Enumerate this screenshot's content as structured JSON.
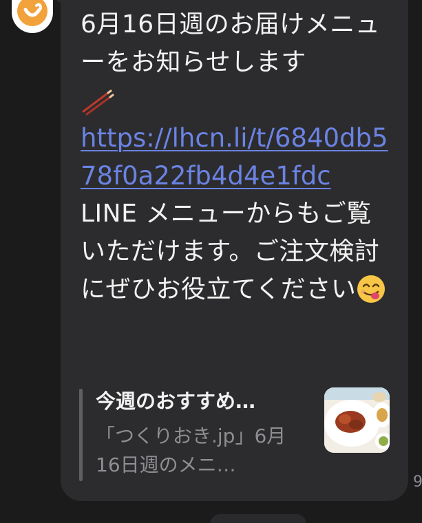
{
  "message": {
    "line1": "6月16日週のお届けメニューをお知らせします",
    "link": "https://lhcn.li/t/6840db578f0a22fb4d4e1fdc",
    "body": "LINE メニューからもご覧いただけます。ご注文検討にぜひお役立てください",
    "emoji_icon": "yum-face-icon",
    "chopsticks_icon": "chopsticks-icon"
  },
  "preview": {
    "title": "今週のおすすめ…",
    "description": "「つくりおき.jp」6月16日週のメニ…",
    "thumbnail_icon": "food-thumbnail"
  },
  "timestamp_stub": "9",
  "colors": {
    "background": "#1b1b1c",
    "bubble": "#2c2c2e",
    "text": "#f2f2f2",
    "link": "#6b83e3",
    "muted": "#8e8e93",
    "avatar": "#f2a23a"
  }
}
